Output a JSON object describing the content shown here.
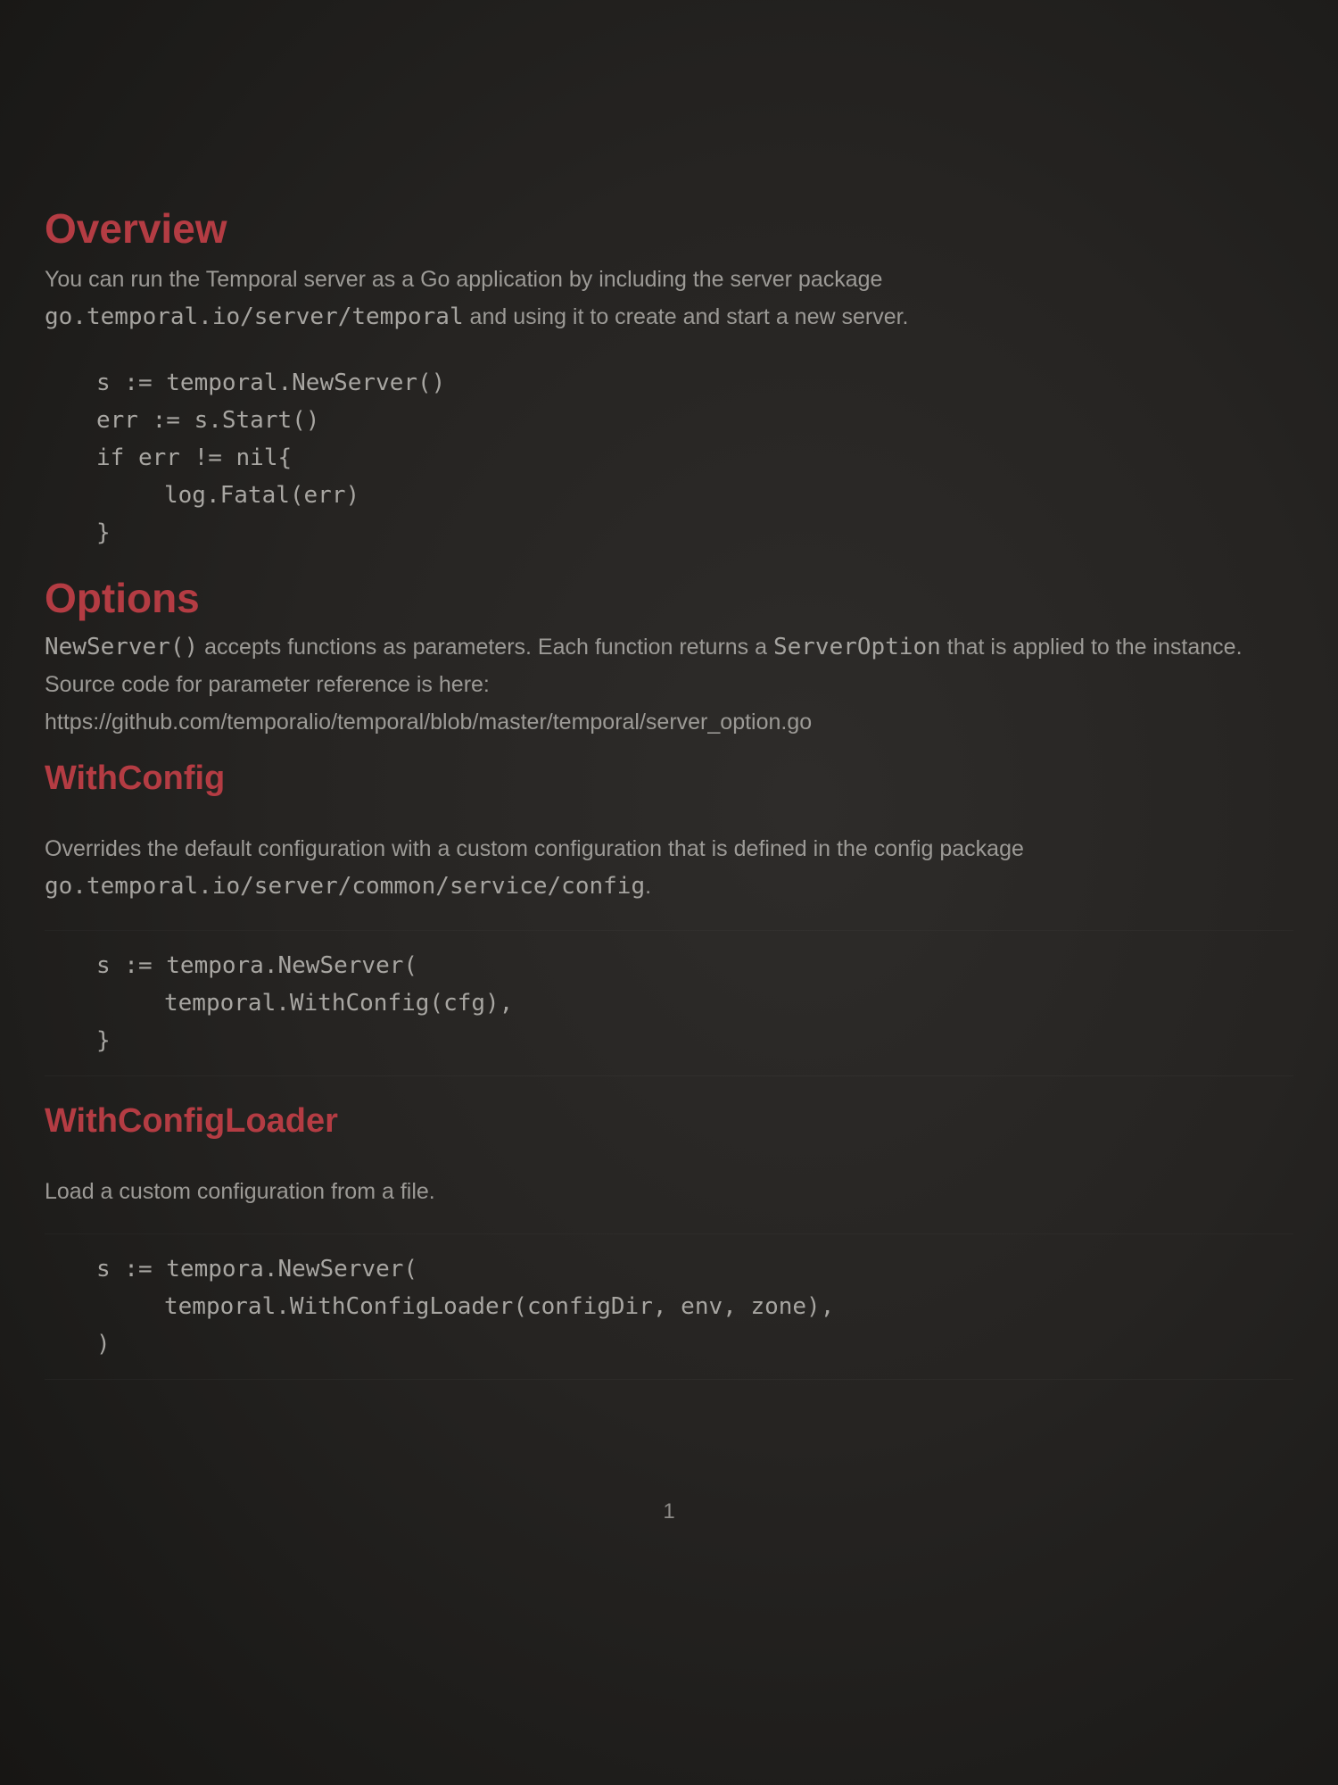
{
  "overview": {
    "heading": "Overview",
    "text_1": "You can run the Temporal server as a Go application by including the server package",
    "code_1": "go.temporal.io/server/temporal",
    "text_2": " and using it to create and start a new server.",
    "code_block": [
      "s := temporal.NewServer()",
      "err := s.Start()",
      "if err != nil{",
      "log.Fatal(err)",
      "}"
    ]
  },
  "options": {
    "heading": "Options",
    "code_1": "NewServer()",
    "text_1": " accepts functions as parameters. Each function returns a ",
    "code_2": "ServerOption",
    "text_2": " that is applied to the instance. Source code for parameter reference is here:",
    "link": "https://github.com/temporalio/temporal/blob/master/temporal/server_option.go"
  },
  "with_config": {
    "heading": "WithConfig",
    "text_1": "Overrides the default configuration with a custom configuration that is defined in the config package",
    "code_1": "go.temporal.io/server/common/service/config",
    "text_2": ".",
    "code_block": [
      "s := tempora.NewServer(",
      "temporal.WithConfig(cfg),",
      "}"
    ]
  },
  "with_config_loader": {
    "heading": "WithConfigLoader",
    "text_1": "Load a custom configuration from a file.",
    "code_block": [
      "s := tempora.NewServer(",
      "temporal.WithConfigLoader(configDir, env, zone),",
      ")"
    ]
  },
  "footer": {
    "page_number": "1"
  }
}
